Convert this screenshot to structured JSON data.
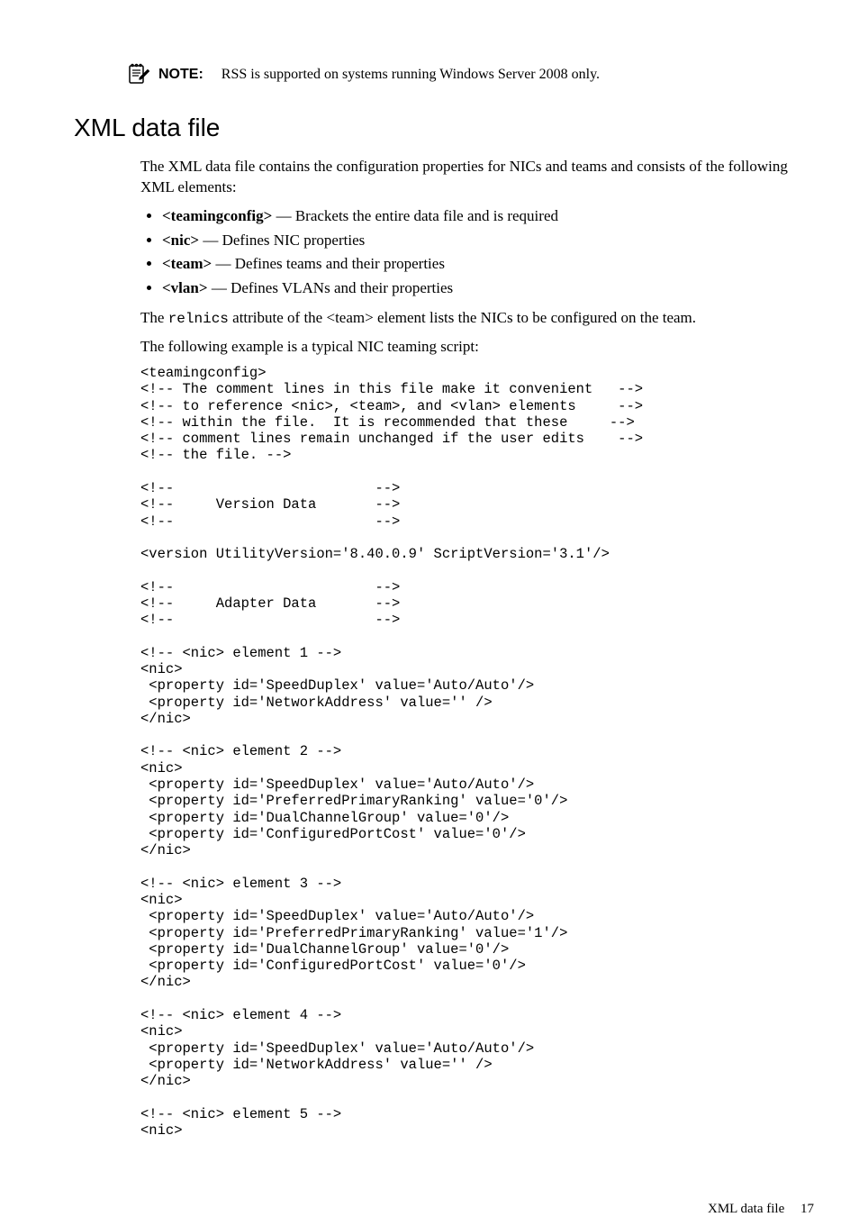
{
  "note": {
    "label": "NOTE:",
    "text": "RSS is supported on systems running Windows Server 2008 only."
  },
  "section": {
    "title": "XML data file",
    "intro": "The XML data file contains the configuration properties for NICs and teams and consists of the following XML elements:",
    "bullets": [
      {
        "tag": "<teamingconfig>",
        "desc": " — Brackets the entire data file and is required"
      },
      {
        "tag": "<nic>",
        "desc": " — Defines NIC properties"
      },
      {
        "tag": "<team>",
        "desc": " — Defines teams and their properties"
      },
      {
        "tag": "<vlan>",
        "desc": " — Defines VLANs and their properties"
      }
    ],
    "relnics_pre": "The ",
    "relnics_code": "relnics",
    "relnics_post": " attribute of the <team> element lists the NICs to be configured on the team.",
    "example_intro": "The following example is a typical NIC teaming script:",
    "code": "<teamingconfig>\n<!-- The comment lines in this file make it convenient   -->\n<!-- to reference <nic>, <team>, and <vlan> elements     -->\n<!-- within the file.  It is recommended that these     -->\n<!-- comment lines remain unchanged if the user edits    -->\n<!-- the file. -->\n\n<!--                        -->\n<!--     Version Data       -->\n<!--                        -->\n\n<version UtilityVersion='8.40.0.9' ScriptVersion='3.1'/>\n\n<!--                        -->\n<!--     Adapter Data       -->\n<!--                        -->\n\n<!-- <nic> element 1 -->\n<nic>\n <property id='SpeedDuplex' value='Auto/Auto'/>\n <property id='NetworkAddress' value='' />\n</nic>\n\n<!-- <nic> element 2 -->\n<nic>\n <property id='SpeedDuplex' value='Auto/Auto'/>\n <property id='PreferredPrimaryRanking' value='0'/>\n <property id='DualChannelGroup' value='0'/>\n <property id='ConfiguredPortCost' value='0'/>\n</nic>\n\n<!-- <nic> element 3 -->\n<nic>\n <property id='SpeedDuplex' value='Auto/Auto'/>\n <property id='PreferredPrimaryRanking' value='1'/>\n <property id='DualChannelGroup' value='0'/>\n <property id='ConfiguredPortCost' value='0'/>\n</nic>\n\n<!-- <nic> element 4 -->\n<nic>\n <property id='SpeedDuplex' value='Auto/Auto'/>\n <property id='NetworkAddress' value='' />\n</nic>\n\n<!-- <nic> element 5 -->\n<nic>"
  },
  "footer": {
    "label": "XML data file",
    "page": "17"
  }
}
